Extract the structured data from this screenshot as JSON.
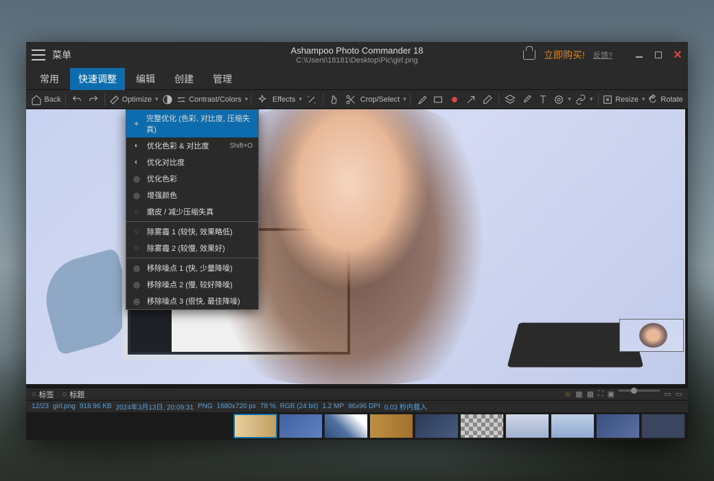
{
  "titlebar": {
    "menu": "菜单",
    "app_title": "Ashampoo Photo Commander 18",
    "path": "C:\\Users\\18181\\Desktop\\Pic\\girl.png",
    "buy_now": "立即购买!",
    "feedback": "反馈?"
  },
  "menubar": {
    "items": [
      "常用",
      "快速调整",
      "编辑",
      "创建",
      "管理"
    ],
    "active_index": 1
  },
  "toolbar": {
    "back": "Back",
    "optimize": "Optimize",
    "contrast": "Contrast/Colors",
    "effects": "Effects",
    "crop": "Crop/Select",
    "resize": "Resize",
    "rotate": "Rotate"
  },
  "optimize_menu": {
    "items": [
      {
        "label": "完整优化 (色彩, 对比度, 压缩失真)",
        "icon": "wand",
        "highlighted": true
      },
      {
        "label": "优化色彩 & 对比度",
        "icon": "contrast",
        "shortcut": "Shift+O"
      },
      {
        "label": "优化对比度",
        "icon": "contrast"
      },
      {
        "label": "优化色彩",
        "icon": "target"
      },
      {
        "label": "增强颜色",
        "icon": "target"
      },
      {
        "label": "磨皮 / 减少压缩失真",
        "icon": "drop"
      }
    ],
    "group2": [
      {
        "label": "除雾霾 1 (较快, 效果略低)",
        "icon": "drop"
      },
      {
        "label": "除雾霾 2 (较慢, 效果好)",
        "icon": "drop"
      }
    ],
    "group3": [
      {
        "label": "移除噪点 1 (快, 少量降噪)",
        "icon": "target"
      },
      {
        "label": "移除噪点 2 (慢, 较好降噪)",
        "icon": "target"
      },
      {
        "label": "移除噪点 3 (很快, 最佳降噪)",
        "icon": "target"
      }
    ]
  },
  "info_bar": {
    "tag": "标签",
    "title": "标题"
  },
  "status": {
    "index": "12/23",
    "filename": "girl.png",
    "size": "918.96 KB",
    "date": "2024年3月13日, 20:09:31",
    "format": "PNG",
    "dimensions": "1680x720 px",
    "zoom": "78 %",
    "colorspace": "RGB (24 bit)",
    "mp": "1.2 MP",
    "dpi": "96x96 DPI",
    "load": "0.03 秒内载入"
  }
}
